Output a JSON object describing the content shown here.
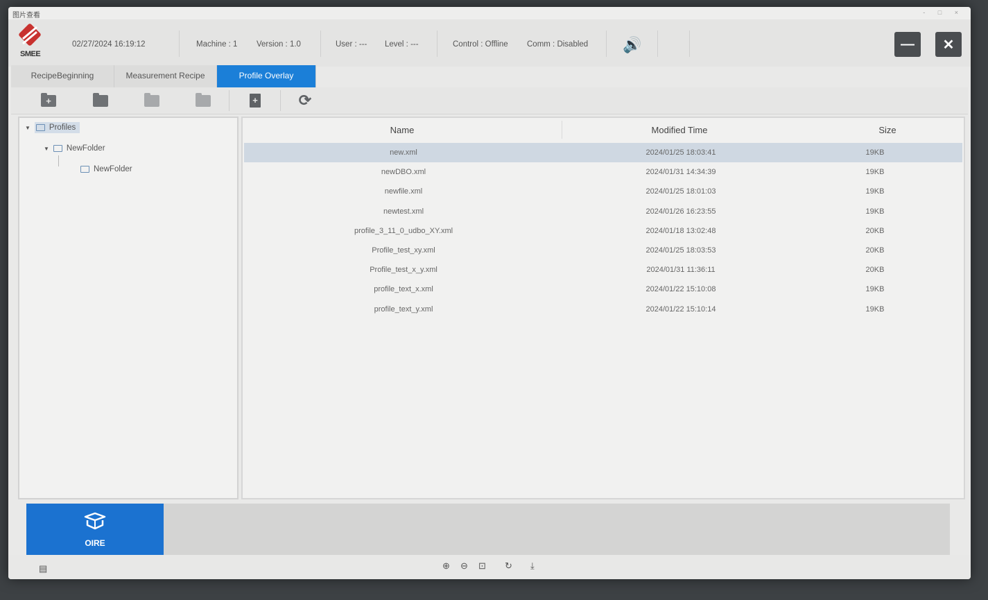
{
  "window": {
    "title": "图片查看",
    "controls": "- □ ×"
  },
  "header": {
    "datetime": "02/27/2024   16:19:12",
    "machine": "Machine : 1",
    "version": "Version : 1.0",
    "user": "User : ---",
    "level": "Level : ---",
    "control": "Control : Offline",
    "comm": "Comm : Disabled",
    "logo_text": "SMEE",
    "minimize_label": "—",
    "close_label": "✕",
    "speaker_glyph": "🔊"
  },
  "tabs": [
    {
      "label": "RecipeBeginning",
      "active": false
    },
    {
      "label": "Measurement Recipe",
      "active": false
    },
    {
      "label": "Profile Overlay",
      "active": true
    }
  ],
  "toolbar": {
    "icons": [
      "new-folder-icon",
      "open-folder-icon",
      "folder-icon",
      "delete-folder-icon",
      "new-file-icon",
      "refresh-icon"
    ],
    "plus": "+",
    "refresh_glyph": "⟳"
  },
  "tree": {
    "root": {
      "label": "Profiles",
      "expanded": true
    },
    "child": {
      "label": "NewFolder",
      "expanded": true
    },
    "grandchild": {
      "label": "NewFolder"
    },
    "expander": "▼"
  },
  "filelist": {
    "columns": {
      "name": "Name",
      "modified": "Modified Time",
      "size": "Size"
    },
    "rows": [
      {
        "name": "new.xml",
        "modified": "2024/01/25 18:03:41",
        "size": "19KB",
        "selected": true
      },
      {
        "name": "newDBO.xml",
        "modified": "2024/01/31 14:34:39",
        "size": "19KB"
      },
      {
        "name": "newfile.xml",
        "modified": "2024/01/25 18:01:03",
        "size": "19KB"
      },
      {
        "name": "newtest.xml",
        "modified": "2024/01/26 16:23:55",
        "size": "19KB"
      },
      {
        "name": "profile_3_11_0_udbo_XY.xml",
        "modified": "2024/01/18 13:02:48",
        "size": "20KB"
      },
      {
        "name": "Profile_test_xy.xml",
        "modified": "2024/01/25 18:03:53",
        "size": "20KB"
      },
      {
        "name": "Profile_test_x_y.xml",
        "modified": "2024/01/31 11:36:11",
        "size": "20KB"
      },
      {
        "name": "profile_text_x.xml",
        "modified": "2024/01/22 15:10:08",
        "size": "19KB"
      },
      {
        "name": "profile_text_y.xml",
        "modified": "2024/01/22 15:10:14",
        "size": "19KB"
      }
    ]
  },
  "bottom": {
    "oire_label": "OIRE"
  },
  "statusbar": {
    "zoom_in": "⊕",
    "zoom_out": "⊖",
    "fit": "⊡",
    "rotate": "↻",
    "download": "⤓",
    "left_icon": "▤"
  },
  "colors": {
    "accent": "#1b7fd8",
    "oire": "#1b72d0",
    "logo": "#c8322f",
    "dark_button": "#4a4d50"
  }
}
